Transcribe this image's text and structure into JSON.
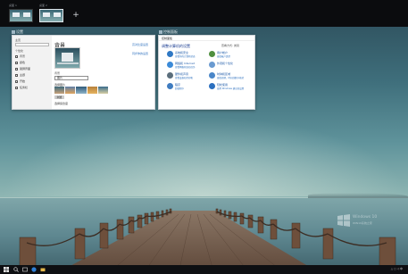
{
  "desktops": [
    {
      "label": "桌面 1"
    },
    {
      "label": "桌面 2"
    }
  ],
  "new_desktop_label": "+",
  "windows": {
    "left": {
      "label": "设置",
      "sidebar": {
        "home": "主页",
        "section": "个性化",
        "items": [
          "背景",
          "颜色",
          "锁屏界面",
          "主题",
          "开始",
          "任务栏"
        ]
      },
      "page_title": "背景",
      "related_1": "高对比度设置",
      "related_2": "同步你的设置",
      "background_label": "背景",
      "background_value": "图片",
      "choose_picture_label": "选择图片",
      "browse_label": "浏览",
      "fit_label": "选择契合度"
    },
    "right": {
      "label": "控制面板",
      "title_bar": "控制面板",
      "heading": "调整计算机的设置",
      "view_by": "查看方式: 类别",
      "items": [
        {
          "title": "系统和安全",
          "sub": "查看你的计算机状态",
          "color": "#2f78c4"
        },
        {
          "title": "网络和 Internet",
          "sub": "查看网络状态和任务",
          "color": "#3b8ad8"
        },
        {
          "title": "硬件和声音",
          "sub": "查看设备和打印机",
          "color": "#5b6e7c"
        },
        {
          "title": "程序",
          "sub": "卸载程序",
          "color": "#3f7cc0"
        },
        {
          "title": "用户帐户",
          "sub": "更改帐户类型",
          "color": "#4f8f3f"
        },
        {
          "title": "外观和个性化",
          "sub": "",
          "color": "#6a9ad0"
        },
        {
          "title": "时钟和区域",
          "sub": "更改日期、时间或数字格式",
          "color": "#4a86c8"
        },
        {
          "title": "轻松使用",
          "sub": "使用 Windows 建议的设置",
          "color": "#2b6fbf"
        }
      ]
    }
  },
  "watermark": {
    "title": "Windows 10",
    "subtitle": "WIN10系统之家"
  },
  "taskbar": {
    "tray_text": "△ ▢ ◁ 中"
  },
  "colors": {
    "sea": "#5e8790",
    "pier": "#7a5a45"
  }
}
